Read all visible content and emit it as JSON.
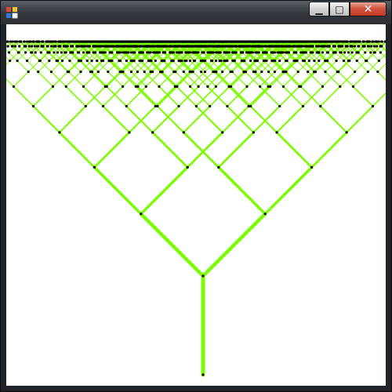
{
  "window": {
    "title": "",
    "controls": {
      "minimize_icon": "minimize-icon",
      "maximize_icon": "maximize-icon",
      "close_icon": "close-icon"
    }
  },
  "tree": {
    "branch_color": "#7CFC00",
    "node_color": "#000000",
    "depth": 10,
    "branch_angle_degrees": 45
  }
}
